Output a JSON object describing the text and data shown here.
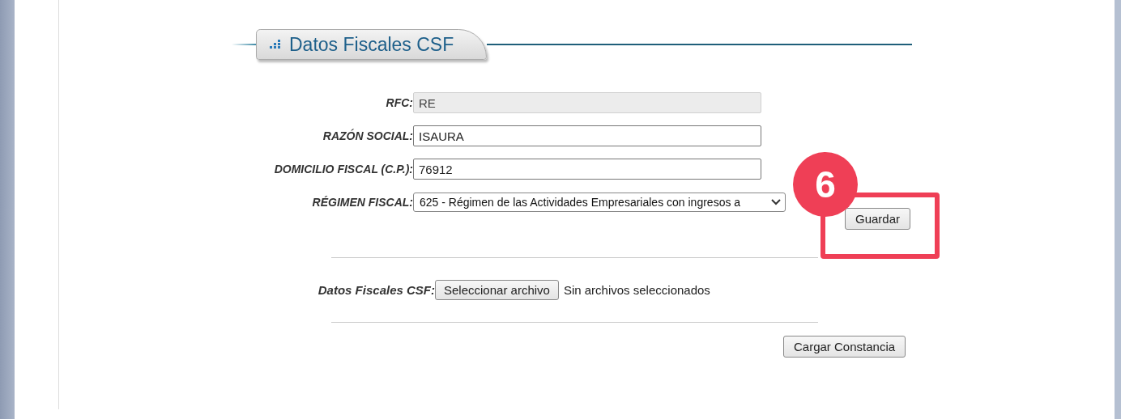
{
  "section": {
    "title": "Datos Fiscales CSF"
  },
  "fields": [
    {
      "kind": "text",
      "label": "RFC:",
      "value": "RE",
      "disabled": true
    },
    {
      "kind": "text",
      "label": "RAZÓN SOCIAL:",
      "value": "ISAURA",
      "disabled": false
    },
    {
      "kind": "text",
      "label": "DOMICILIO FISCAL (C.P.):",
      "value": "76912",
      "disabled": false
    },
    {
      "kind": "select",
      "label": "RÉGIMEN FISCAL:",
      "value": "625 - Régimen de las Actividades Empresariales con ingresos a"
    }
  ],
  "save_button": "Guardar",
  "file": {
    "label": "Datos Fiscales CSF:",
    "button": "Seleccionar archivo",
    "status": "Sin archivos seleccionados"
  },
  "upload_button": "Cargar Constancia",
  "annotation": {
    "number": "6"
  }
}
